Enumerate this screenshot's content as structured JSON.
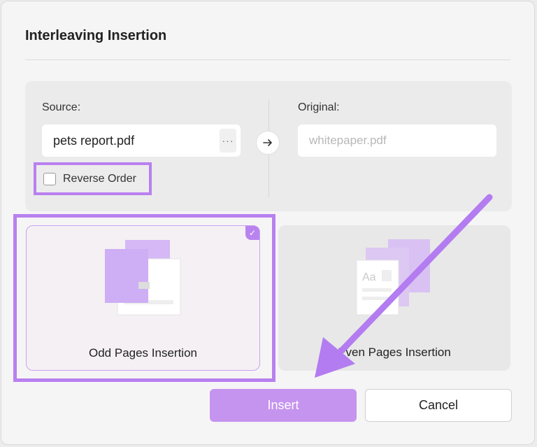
{
  "dialog": {
    "title": "Interleaving Insertion"
  },
  "source": {
    "label": "Source:",
    "value": "pets report.pdf",
    "more_label": "···"
  },
  "original": {
    "label": "Original:",
    "placeholder": "whitepaper.pdf"
  },
  "reverse_order": {
    "label": "Reverse Order",
    "checked": false
  },
  "options": [
    {
      "label": "Odd Pages Insertion",
      "selected": true
    },
    {
      "label": "Even Pages Insertion",
      "selected": false
    }
  ],
  "buttons": {
    "insert": "Insert",
    "cancel": "Cancel"
  },
  "colors": {
    "accent": "#c594ef",
    "highlight": "#b980ef"
  }
}
